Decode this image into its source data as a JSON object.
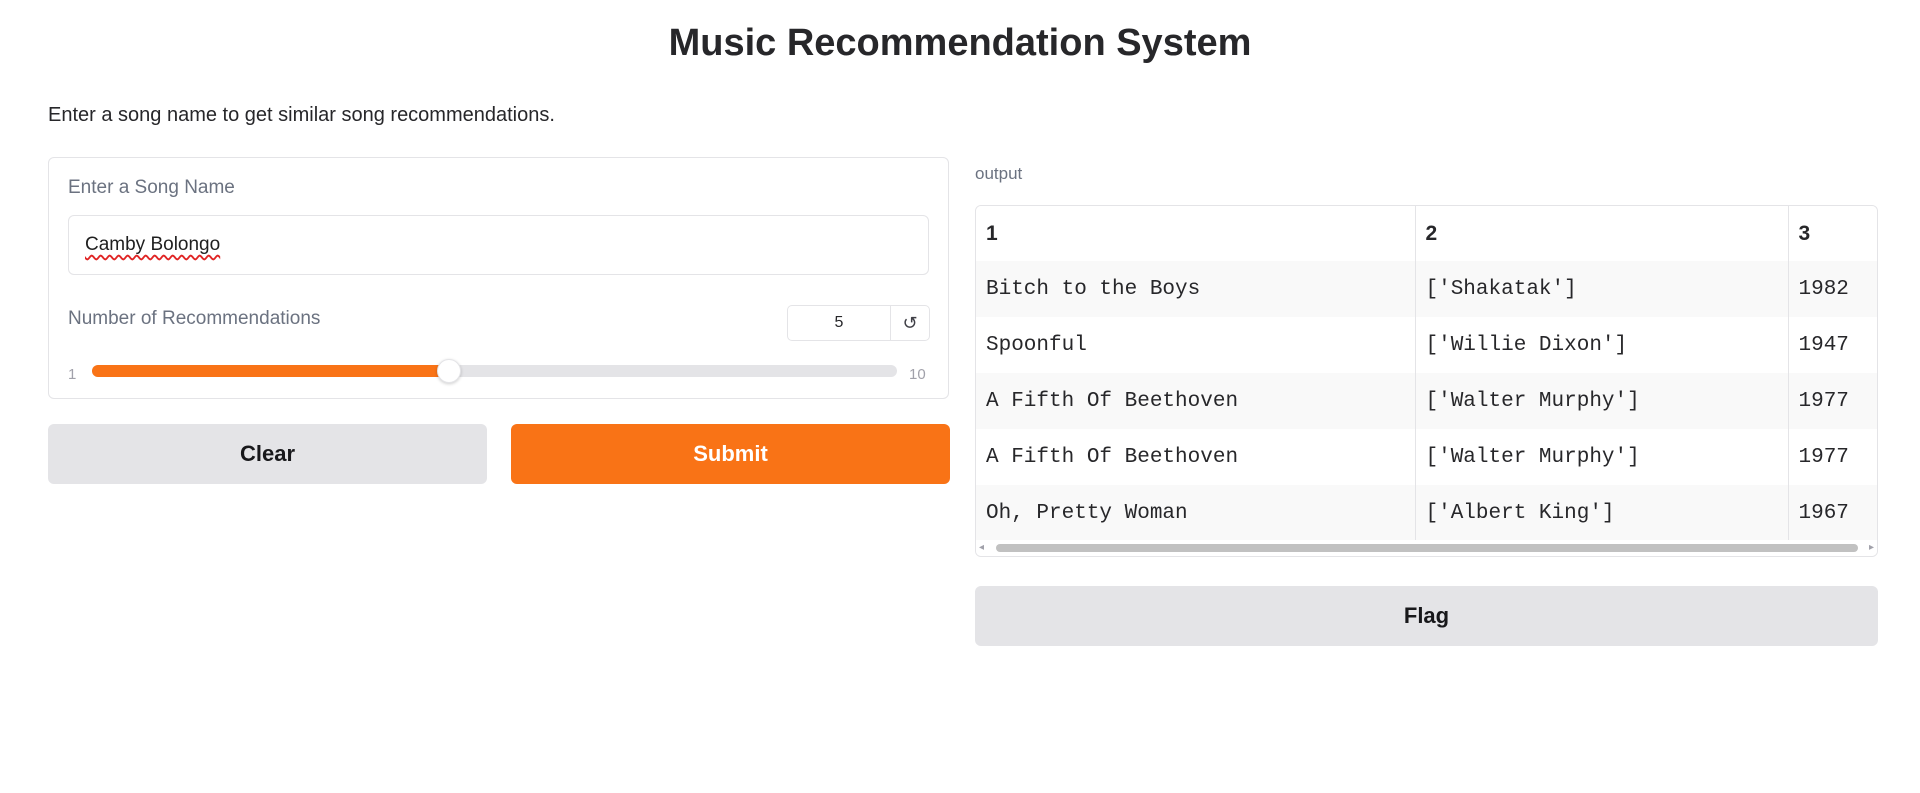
{
  "header": {
    "title": "Music Recommendation System",
    "description": "Enter a song name to get similar song recommendations."
  },
  "song_input": {
    "label": "Enter a Song Name",
    "value": "Camby Bolongo"
  },
  "recommendations_slider": {
    "label": "Number of Recommendations",
    "value": "5",
    "min": "1",
    "max": "10",
    "fraction": 0.444
  },
  "buttons": {
    "clear": "Clear",
    "submit": "Submit",
    "flag": "Flag"
  },
  "output": {
    "label": "output",
    "headers": [
      "1",
      "2",
      "3"
    ],
    "rows": [
      [
        "Bitch to the Boys",
        "['Shakatak']",
        "1982"
      ],
      [
        "Spoonful",
        "['Willie Dixon']",
        "1947"
      ],
      [
        "A Fifth Of Beethoven",
        "['Walter Murphy']",
        "1977"
      ],
      [
        "A Fifth Of Beethoven",
        "['Walter Murphy']",
        "1977"
      ],
      [
        "Oh, Pretty Woman",
        "['Albert King']",
        "1967"
      ]
    ]
  },
  "icons": {
    "reset": "reset-icon"
  },
  "colors": {
    "accent": "#f97316",
    "button_secondary": "#e4e4e7",
    "border": "#e4e4e7"
  }
}
